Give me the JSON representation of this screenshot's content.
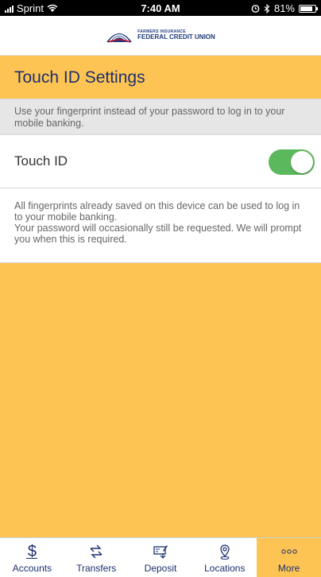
{
  "status_bar": {
    "carrier": "Sprint",
    "time": "7:40 AM",
    "battery": "81%",
    "battery_level": 0.81
  },
  "logo": {
    "line1": "FARMERS INSURANCE",
    "line2": "FEDERAL CREDIT UNION"
  },
  "page": {
    "title": "Touch ID Settings",
    "intro": "Use your fingerprint instead of your password to log in to your mobile banking."
  },
  "touch_id": {
    "label": "Touch ID",
    "enabled": true,
    "on_color": "#5cb85c"
  },
  "notes": {
    "line1": "All fingerprints already saved on this device can be used to log in to your mobile banking.",
    "line2": "Your password will occasionally still be requested. We will prompt you when this is required."
  },
  "tabs": [
    {
      "label": "Accounts",
      "icon": "dollar-icon"
    },
    {
      "label": "Transfers",
      "icon": "transfer-arrows-icon"
    },
    {
      "label": "Deposit",
      "icon": "check-deposit-icon"
    },
    {
      "label": "Locations",
      "icon": "location-pin-icon"
    },
    {
      "label": "More",
      "icon": "more-dots-icon",
      "active": true
    }
  ],
  "colors": {
    "brand_yellow": "#FDC453",
    "brand_navy": "#1d2f6e"
  }
}
